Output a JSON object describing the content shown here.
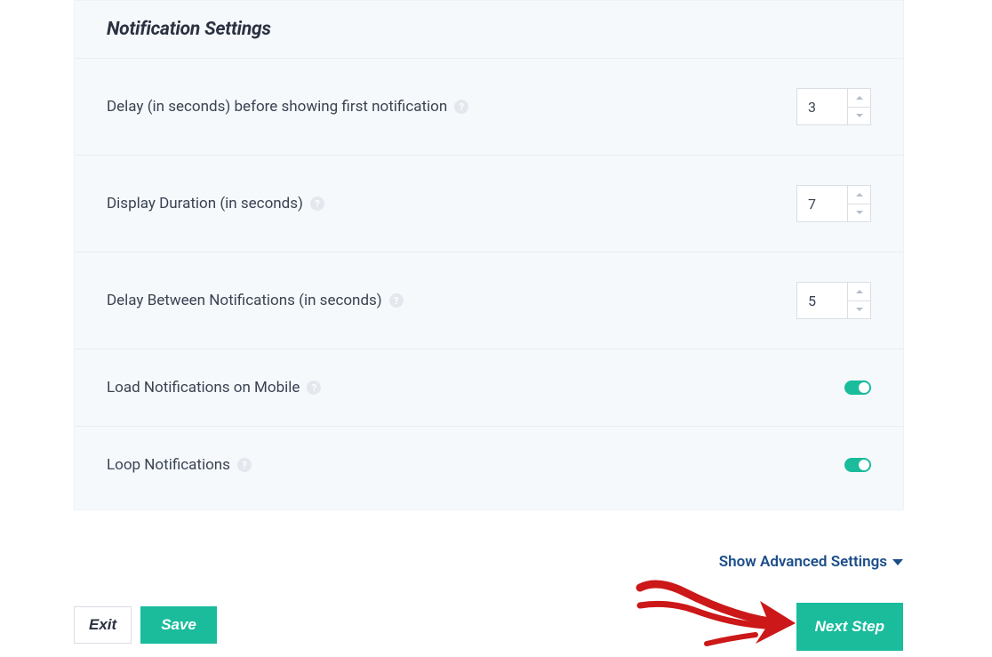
{
  "panel": {
    "title": "Notification Settings",
    "rows": [
      {
        "label": "Delay (in seconds) before showing first notification",
        "value": "3"
      },
      {
        "label": "Display Duration (in seconds)",
        "value": "7"
      },
      {
        "label": "Delay Between Notifications (in seconds)",
        "value": "5"
      },
      {
        "label": "Load Notifications on Mobile",
        "toggle": true
      },
      {
        "label": "Loop Notifications",
        "toggle": true
      }
    ]
  },
  "links": {
    "advanced": "Show Advanced Settings"
  },
  "buttons": {
    "exit": "Exit",
    "save": "Save",
    "next": "Next Step"
  }
}
